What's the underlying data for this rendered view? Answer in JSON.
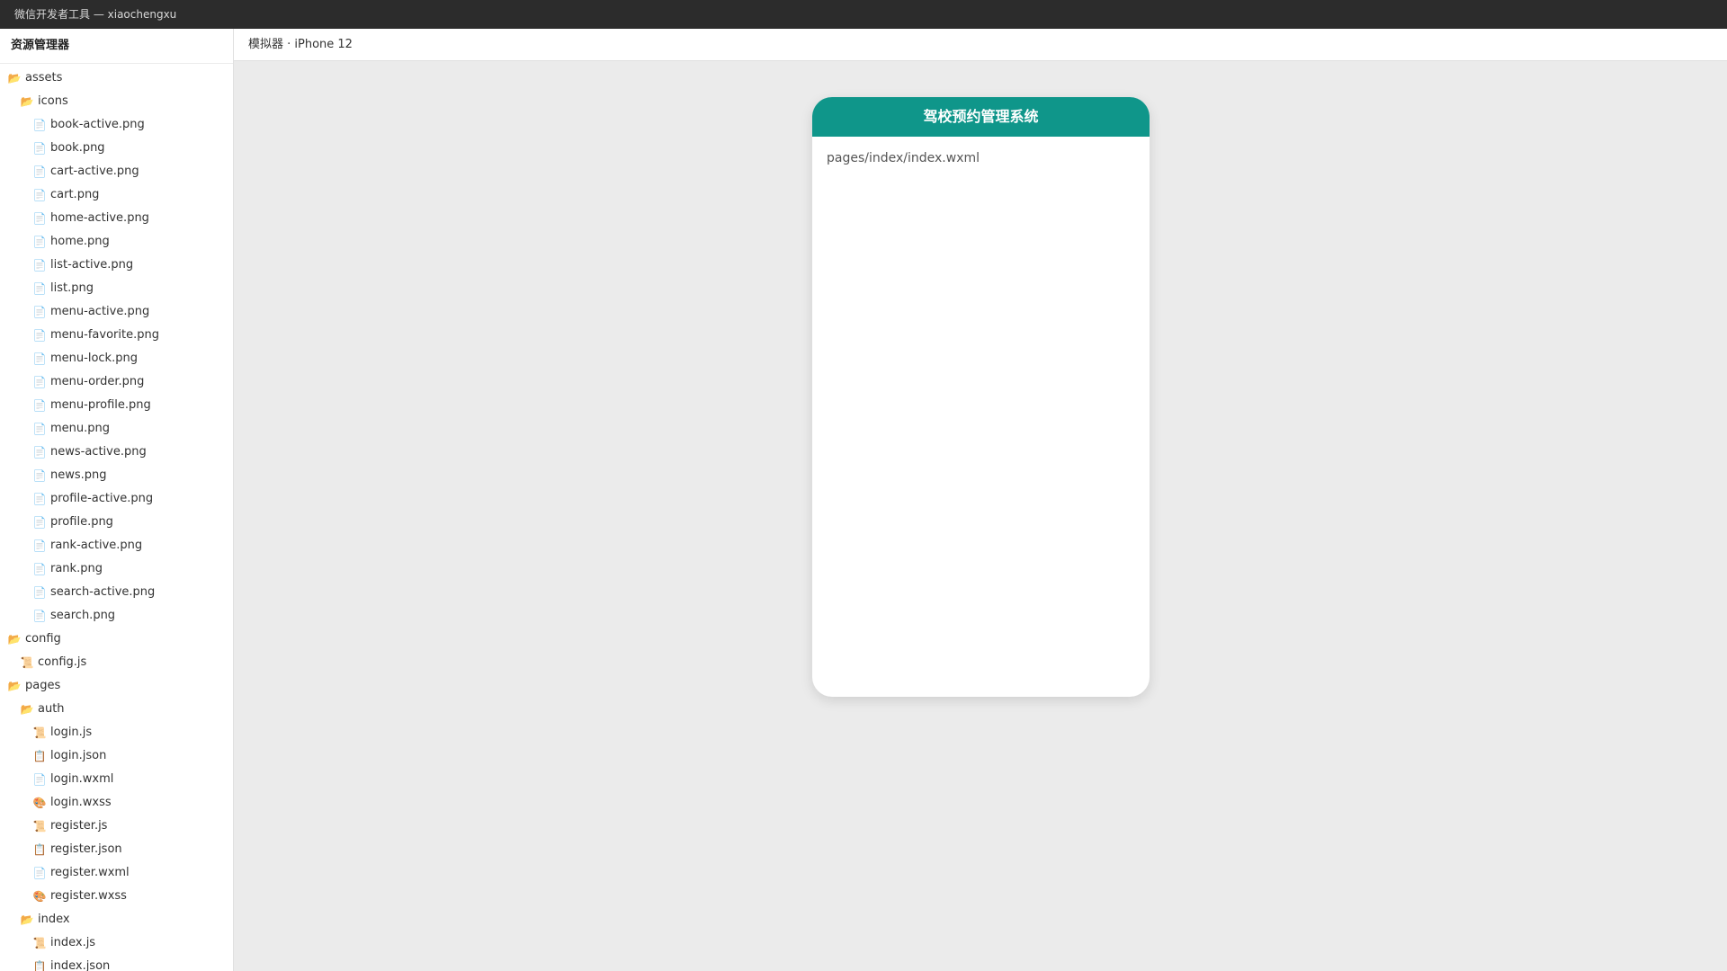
{
  "window": {
    "title": "微信开发者工具 — xiaochengxu"
  },
  "sidebar": {
    "title": "资源管理器",
    "items": [
      {
        "label": "assets",
        "depth": 0,
        "icon": "folder-open-icon",
        "glyph": "📂"
      },
      {
        "label": "icons",
        "depth": 1,
        "icon": "folder-open-icon",
        "glyph": "📂"
      },
      {
        "label": "book-active.png",
        "depth": 2,
        "icon": "file-icon",
        "glyph": "📄"
      },
      {
        "label": "book.png",
        "depth": 2,
        "icon": "file-icon",
        "glyph": "📄"
      },
      {
        "label": "cart-active.png",
        "depth": 2,
        "icon": "file-icon",
        "glyph": "📄"
      },
      {
        "label": "cart.png",
        "depth": 2,
        "icon": "file-icon",
        "glyph": "📄"
      },
      {
        "label": "home-active.png",
        "depth": 2,
        "icon": "file-icon",
        "glyph": "📄"
      },
      {
        "label": "home.png",
        "depth": 2,
        "icon": "file-icon",
        "glyph": "📄"
      },
      {
        "label": "list-active.png",
        "depth": 2,
        "icon": "file-icon",
        "glyph": "📄"
      },
      {
        "label": "list.png",
        "depth": 2,
        "icon": "file-icon",
        "glyph": "📄"
      },
      {
        "label": "menu-active.png",
        "depth": 2,
        "icon": "file-icon",
        "glyph": "📄"
      },
      {
        "label": "menu-favorite.png",
        "depth": 2,
        "icon": "file-icon",
        "glyph": "📄"
      },
      {
        "label": "menu-lock.png",
        "depth": 2,
        "icon": "file-icon",
        "glyph": "📄"
      },
      {
        "label": "menu-order.png",
        "depth": 2,
        "icon": "file-icon",
        "glyph": "📄"
      },
      {
        "label": "menu-profile.png",
        "depth": 2,
        "icon": "file-icon",
        "glyph": "📄"
      },
      {
        "label": "menu.png",
        "depth": 2,
        "icon": "file-icon",
        "glyph": "📄"
      },
      {
        "label": "news-active.png",
        "depth": 2,
        "icon": "file-icon",
        "glyph": "📄"
      },
      {
        "label": "news.png",
        "depth": 2,
        "icon": "file-icon",
        "glyph": "📄"
      },
      {
        "label": "profile-active.png",
        "depth": 2,
        "icon": "file-icon",
        "glyph": "📄"
      },
      {
        "label": "profile.png",
        "depth": 2,
        "icon": "file-icon",
        "glyph": "📄"
      },
      {
        "label": "rank-active.png",
        "depth": 2,
        "icon": "file-icon",
        "glyph": "📄"
      },
      {
        "label": "rank.png",
        "depth": 2,
        "icon": "file-icon",
        "glyph": "📄"
      },
      {
        "label": "search-active.png",
        "depth": 2,
        "icon": "file-icon",
        "glyph": "📄"
      },
      {
        "label": "search.png",
        "depth": 2,
        "icon": "file-icon",
        "glyph": "📄"
      },
      {
        "label": "config",
        "depth": 0,
        "icon": "folder-open-icon",
        "glyph": "📂"
      },
      {
        "label": "config.js",
        "depth": 1,
        "icon": "js-file-icon",
        "glyph": "📜"
      },
      {
        "label": "pages",
        "depth": 0,
        "icon": "folder-open-icon",
        "glyph": "📂"
      },
      {
        "label": "auth",
        "depth": 1,
        "icon": "folder-open-icon",
        "glyph": "📂"
      },
      {
        "label": "login.js",
        "depth": 2,
        "icon": "js-file-icon",
        "glyph": "📜"
      },
      {
        "label": "login.json",
        "depth": 2,
        "icon": "json-file-icon",
        "glyph": "📋"
      },
      {
        "label": "login.wxml",
        "depth": 2,
        "icon": "file-icon",
        "glyph": "📄"
      },
      {
        "label": "login.wxss",
        "depth": 2,
        "icon": "style-file-icon",
        "glyph": "🎨"
      },
      {
        "label": "register.js",
        "depth": 2,
        "icon": "js-file-icon",
        "glyph": "📜"
      },
      {
        "label": "register.json",
        "depth": 2,
        "icon": "json-file-icon",
        "glyph": "📋"
      },
      {
        "label": "register.wxml",
        "depth": 2,
        "icon": "file-icon",
        "glyph": "📄"
      },
      {
        "label": "register.wxss",
        "depth": 2,
        "icon": "style-file-icon",
        "glyph": "🎨"
      },
      {
        "label": "index",
        "depth": 1,
        "icon": "folder-open-icon",
        "glyph": "📂"
      },
      {
        "label": "index.js",
        "depth": 2,
        "icon": "js-file-icon",
        "glyph": "📜"
      },
      {
        "label": "index.json",
        "depth": 2,
        "icon": "json-file-icon",
        "glyph": "📋"
      }
    ]
  },
  "simulator": {
    "header": "模拟器 · iPhone 12",
    "phone_title": "驾校预约管理系统",
    "page_path": "pages/index/index.wxml"
  },
  "colors": {
    "titlebar": "#2c2c2c",
    "accent": "#0f968a"
  }
}
